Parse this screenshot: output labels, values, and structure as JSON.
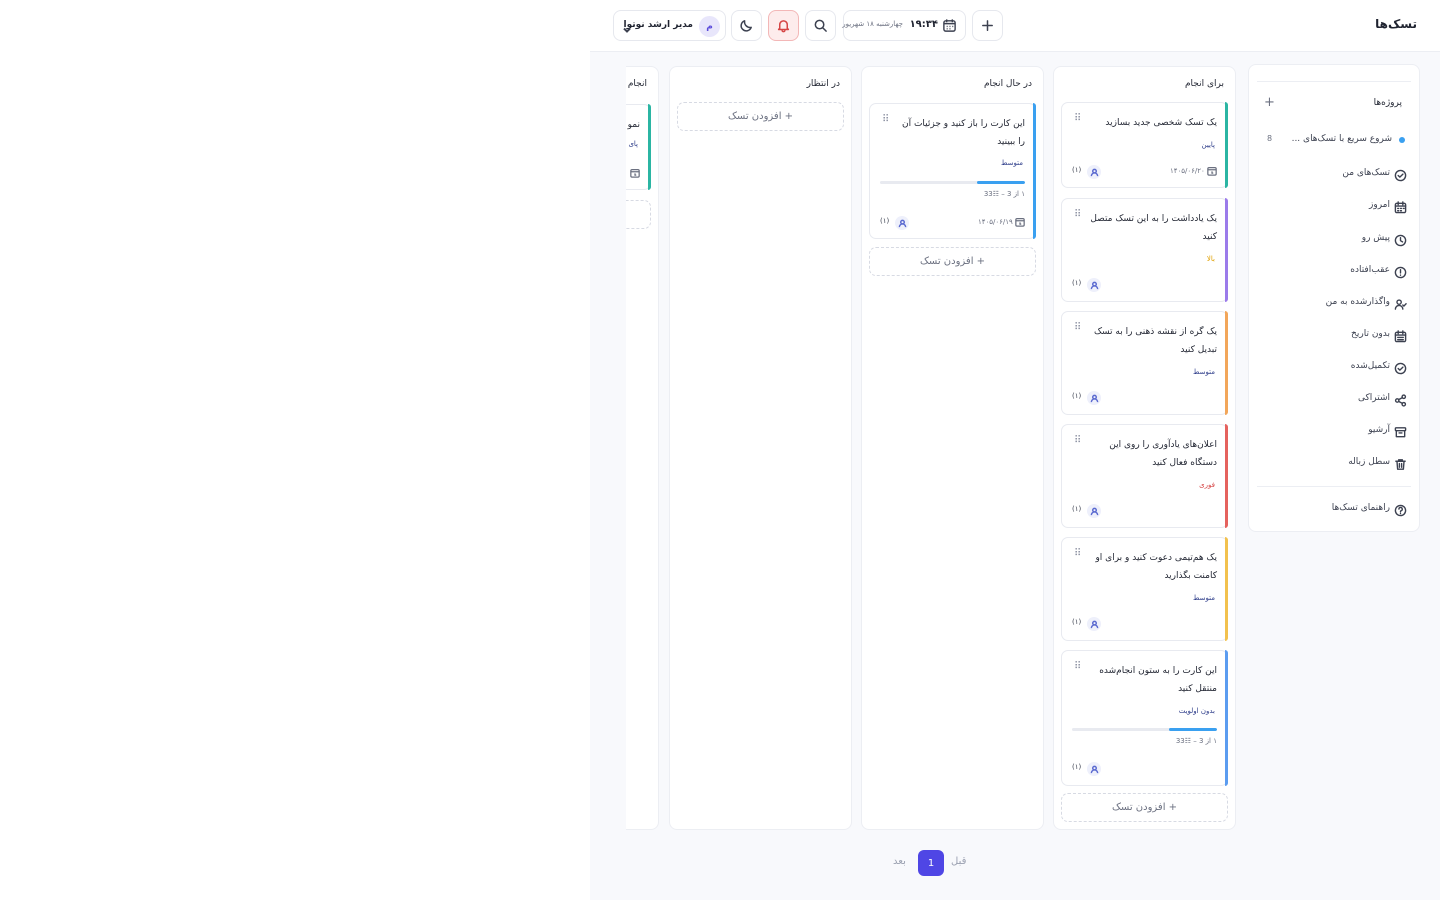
{
  "header": {
    "title": "تسک‌ها",
    "time": "۱۹:۳۴",
    "date": "چهارشنبه ۱۸ شهریور",
    "user_name": "مدیر ارشد نوتوا",
    "user_initial": "م"
  },
  "sidebar": {
    "projects_label": "پروژه‌ها",
    "add_symbol": "+",
    "project": {
      "name": "شروع سریع با تسک‌های ...",
      "count": "8",
      "color": "#3aa0f0"
    },
    "items": [
      {
        "label": "تسک‌های من",
        "icon": "check-circle-icon"
      },
      {
        "label": "امروز",
        "icon": "calendar-icon"
      },
      {
        "label": "پیش رو",
        "icon": "clock-icon"
      },
      {
        "label": "عقب‌افتاده",
        "icon": "alert-circle-icon"
      },
      {
        "label": "واگذارشده به من",
        "icon": "user-check-icon"
      },
      {
        "label": "بدون تاریخ",
        "icon": "calendar-off-icon"
      },
      {
        "label": "تکمیل‌شده",
        "icon": "check-circle-icon"
      },
      {
        "label": "اشتراکی",
        "icon": "share-icon"
      },
      {
        "label": "آرشیو",
        "icon": "archive-icon"
      },
      {
        "label": "سطل زباله",
        "icon": "trash-icon"
      }
    ],
    "help": {
      "label": "راهنمای تسک‌ها",
      "icon": "help-circle-icon"
    }
  },
  "board": {
    "add_task_label": "+ افزودن تسک",
    "columns": [
      {
        "title": "برای انجام",
        "cards": [
          {
            "title": "یک تسک شخصی جدید بسازید",
            "priority": "پایین",
            "priority_color": "#2e3d8a",
            "accent": "#2bb5a3",
            "date": "۱۴۰۵/۰۶/۲۰",
            "assignees": "(۱)"
          },
          {
            "title": "یک یادداشت را به این تسک متصل کنید",
            "priority": "بالا",
            "priority_color": "#e0a000",
            "accent": "#9b7bea",
            "assignees": "(۱)"
          },
          {
            "title": "یک گره از نقشه ذهنی را به تسک تبدیل کنید",
            "priority": "متوسط",
            "priority_color": "#2e3d8a",
            "accent": "#f2a65a",
            "assignees": "(۱)"
          },
          {
            "title": "اعلان‌های یادآوری را روی این دستگاه فعال کنید",
            "priority": "فوری",
            "priority_color": "#d64545",
            "accent": "#e5625e",
            "assignees": "(۱)"
          },
          {
            "title": "یک هم‌تیمی دعوت کنید و برای او کامنت بگذارید",
            "priority": "متوسط",
            "priority_color": "#2e3d8a",
            "accent": "#f2c14e",
            "assignees": "(۱)"
          },
          {
            "title": "این کارت را به ستون انجام‌شده منتقل کنید",
            "priority": "بدون اولویت",
            "priority_color": "#2e3d8a",
            "accent": "#5b9cf0",
            "subtasks": "۱ از 3 – ☷33",
            "progress": 0.33,
            "assignees": "(۱)"
          }
        ]
      },
      {
        "title": "در حال انجام",
        "cards": [
          {
            "title": "این کارت را باز کنید و جزئیات آن را ببینید",
            "priority": "متوسط",
            "priority_color": "#2e3d8a",
            "accent": "#3aa0f0",
            "subtasks": "۱ از 3 – ☷33",
            "progress": 0.33,
            "date": "۱۴۰۵/۰۶/۱۹",
            "assignees": "(۱)"
          }
        ]
      },
      {
        "title": "در انتظار",
        "cards": []
      },
      {
        "title": "انجام",
        "cards": [
          {
            "title": "نمو",
            "priority": "پای",
            "accent": "#2bb5a3"
          }
        ]
      }
    ]
  },
  "pagination": {
    "prev": "قبل",
    "page": "1",
    "next": "بعد"
  }
}
